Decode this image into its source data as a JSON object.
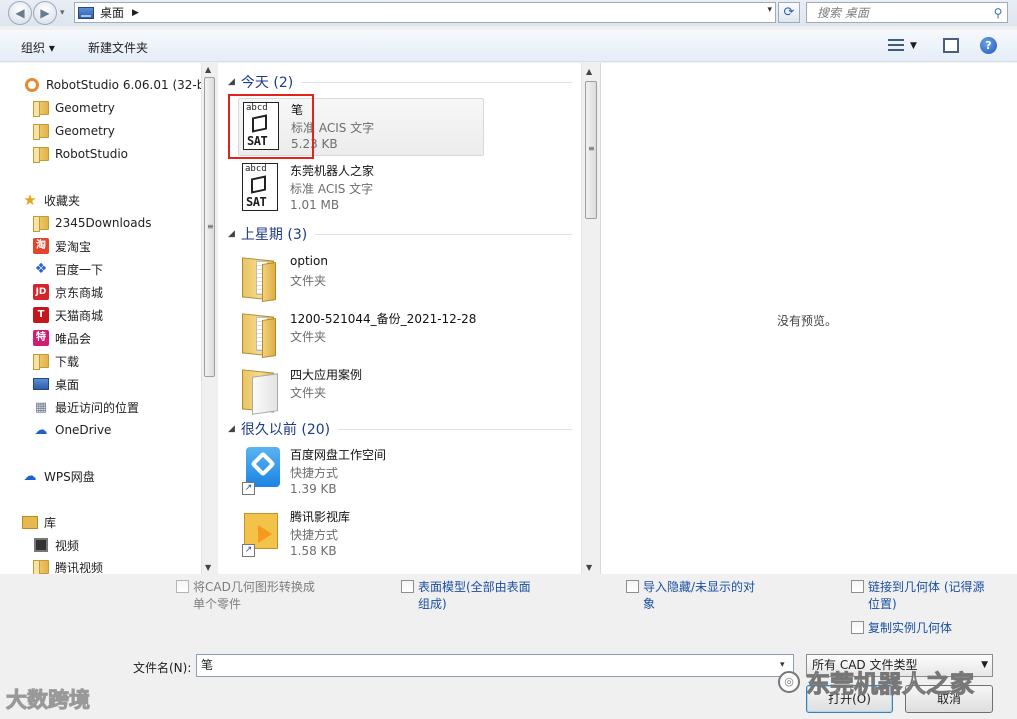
{
  "address_bar": {
    "location": "桌面",
    "search_placeholder": "搜索 桌面"
  },
  "toolbar": {
    "organize": "组织 ▾",
    "new_folder": "新建文件夹"
  },
  "nav": {
    "items": [
      {
        "label": "RobotStudio 6.06.01 (32-bi",
        "icon": "robotstudio-icon"
      },
      {
        "label": "Geometry",
        "icon": "folder-icon"
      },
      {
        "label": "Geometry",
        "icon": "folder-icon"
      },
      {
        "label": "RobotStudio",
        "icon": "folder-icon"
      },
      {
        "label": "收藏夹",
        "icon": "star-icon"
      },
      {
        "label": "2345Downloads",
        "icon": "folder-icon"
      },
      {
        "label": "爱淘宝",
        "icon": "taobao-icon",
        "badge": "淘"
      },
      {
        "label": "百度一下",
        "icon": "baidu-paw-icon"
      },
      {
        "label": "京东商城",
        "icon": "jd-icon",
        "badge": "JD"
      },
      {
        "label": "天猫商城",
        "icon": "tmall-icon",
        "badge": "T"
      },
      {
        "label": "唯品会",
        "icon": "vip-icon",
        "badge": "特"
      },
      {
        "label": "下载",
        "icon": "download-folder-icon"
      },
      {
        "label": "桌面",
        "icon": "desktop-icon"
      },
      {
        "label": "最近访问的位置",
        "icon": "recent-places-icon"
      },
      {
        "label": "OneDrive",
        "icon": "onedrive-cloud-icon"
      },
      {
        "label": "WPS网盘",
        "icon": "wps-cloud-icon"
      },
      {
        "label": "库",
        "icon": "library-icon"
      },
      {
        "label": "视频",
        "icon": "video-icon"
      },
      {
        "label": "腾讯视频",
        "icon": "tencent-video-icon"
      }
    ]
  },
  "files": {
    "groups": [
      {
        "title": "今天 (2)"
      },
      {
        "title": "上星期 (3)"
      },
      {
        "title": "很久以前 (20)"
      }
    ],
    "items": [
      {
        "name": "笔",
        "type": "标准 ACIS 文字",
        "size": "5.23 KB",
        "icon": "sat-file-icon"
      },
      {
        "name": "东莞机器人之家",
        "type": "标准 ACIS 文字",
        "size": "1.01 MB",
        "icon": "sat-file-icon"
      },
      {
        "name": "option",
        "type": "文件夹",
        "icon": "folder-icon"
      },
      {
        "name": "1200-521044_备份_2021-12-28",
        "type": "文件夹",
        "icon": "folder-icon"
      },
      {
        "name": "四大应用案例",
        "type": "文件夹",
        "icon": "folder-icon"
      },
      {
        "name": "百度网盘工作空间",
        "type": "快捷方式",
        "size": "1.39 KB",
        "icon": "baidu-netdisk-icon"
      },
      {
        "name": "腾讯影视库",
        "type": "快捷方式",
        "size": "1.58 KB",
        "icon": "tencent-video-library-icon"
      }
    ],
    "sat_text_top": "abcd",
    "sat_text_bottom": "SAT"
  },
  "preview": {
    "empty_text": "没有预览。"
  },
  "options": {
    "convert_cad": "将CAD几何图形转换成单个零件",
    "surface_model": "表面模型(全部由表面组成)",
    "import_hidden": "导入隐藏/未显示的对象",
    "link_geometry": "链接到几何体 (记得源位置)",
    "copy_instance": "复制实例几何体"
  },
  "footer": {
    "filename_label": "文件名(N):",
    "filename_value": "笔",
    "filetype_value": "所有 CAD 文件类型",
    "open_button": "打开(O)",
    "cancel_button": "取消"
  },
  "watermarks": {
    "left": "大数跨境",
    "right": "东莞机器人之家"
  }
}
